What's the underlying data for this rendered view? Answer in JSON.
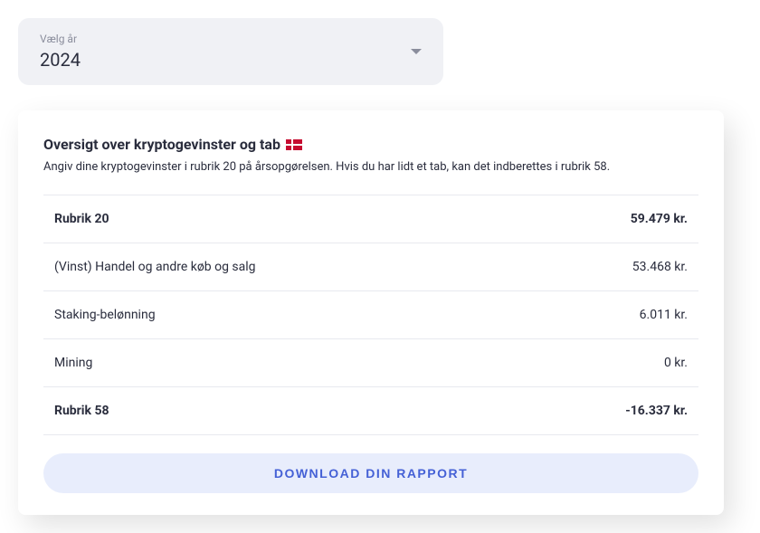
{
  "year_selector": {
    "label": "Vælg år",
    "value": "2024"
  },
  "card": {
    "title": "Oversigt over kryptogevinster og tab",
    "flag": "denmark-flag",
    "subtitle": "Angiv dine kryptogevinster i rubrik 20 på årsopgørelsen. Hvis du har lidt et tab, kan det indberettes i rubrik 58.",
    "rows": [
      {
        "label": "Rubrik 20",
        "value": "59.479 kr.",
        "bold": true
      },
      {
        "label": "(Vinst) Handel og andre køb og salg",
        "value": "53.468 kr.",
        "bold": false
      },
      {
        "label": "Staking-belønning",
        "value": "6.011 kr.",
        "bold": false
      },
      {
        "label": "Mining",
        "value": "0 kr.",
        "bold": false
      },
      {
        "label": "Rubrik 58",
        "value": "-16.337 kr.",
        "bold": true
      }
    ],
    "download_button": "DOWNLOAD DIN RAPPORT"
  }
}
